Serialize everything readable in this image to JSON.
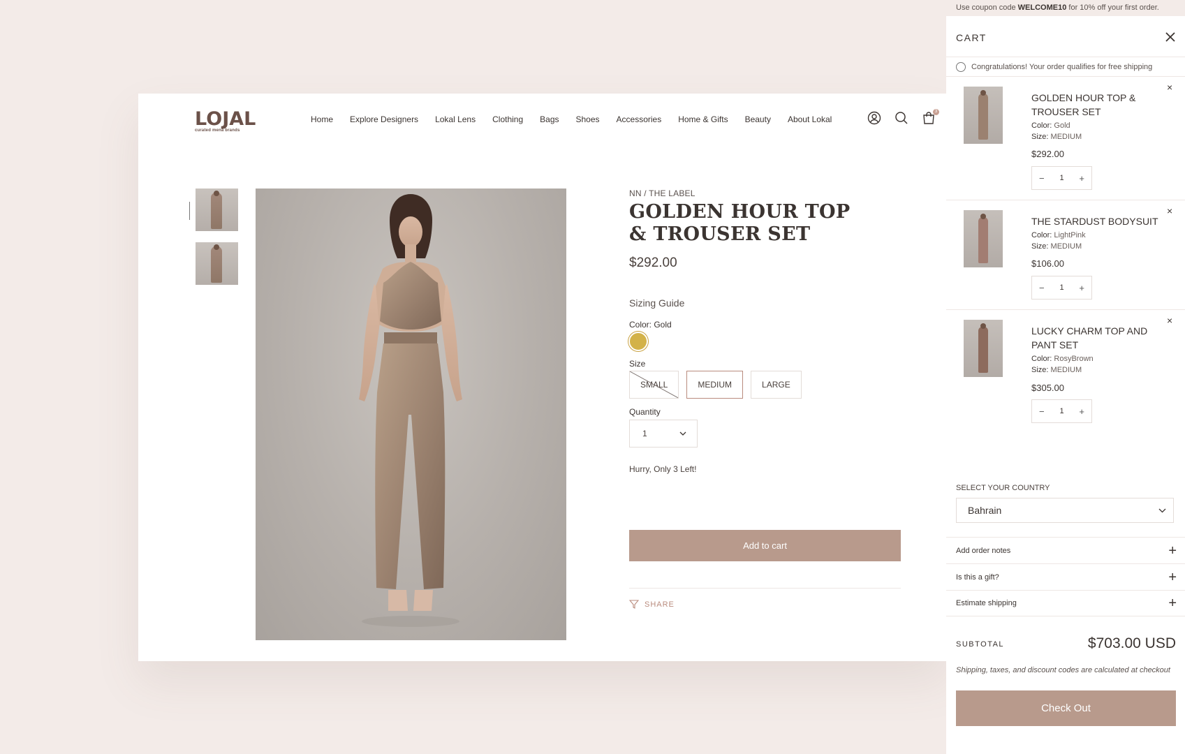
{
  "header": {
    "logo_text": "LOJAL",
    "logo_tagline": "curated mena brands",
    "nav": [
      "Home",
      "Explore Designers",
      "Lokal Lens",
      "Clothing",
      "Bags",
      "Shoes",
      "Accessories",
      "Home & Gifts",
      "Beauty",
      "About Lokal"
    ],
    "cart_count": "3"
  },
  "product": {
    "brand": "NN / THE LABEL",
    "title": "GOLDEN HOUR TOP & TROUSER SET",
    "price": "$292.00",
    "sizing_guide": "Sizing Guide",
    "color_label": "Color: Gold",
    "color_hex": "#d3b249",
    "size_label": "Size",
    "sizes": [
      "SMALL",
      "MEDIUM",
      "LARGE"
    ],
    "selected_size": "MEDIUM",
    "unavailable_size": "SMALL",
    "quantity_label": "Quantity",
    "quantity_value": "1",
    "stock_note": "Hurry, Only 3 Left!",
    "add_to_cart": "Add to cart",
    "share": "SHARE"
  },
  "cart": {
    "coupon_prefix": "Use coupon code ",
    "coupon_code": "WELCOME10",
    "coupon_suffix": " for 10% off your first order.",
    "title": "CART",
    "free_shipping": "Congratulations! Your order qualifies for free shipping",
    "items": [
      {
        "name": "GOLDEN HOUR TOP & TROUSER SET",
        "color_key": "Color:",
        "color": "Gold",
        "size_key": "Size:",
        "size": "MEDIUM",
        "price": "$292.00",
        "qty": "1",
        "swatch": "#9b8170"
      },
      {
        "name": "THE STARDUST BODYSUIT",
        "color_key": "Color:",
        "color": "LightPink",
        "size_key": "Size:",
        "size": "MEDIUM",
        "price": "$106.00",
        "qty": "1",
        "swatch": "#a27d72"
      },
      {
        "name": "LUCKY CHARM TOP AND PANT SET",
        "color_key": "Color:",
        "color": "RosyBrown",
        "size_key": "Size:",
        "size": "MEDIUM",
        "price": "$305.00",
        "qty": "1",
        "swatch": "#8d6b5d"
      }
    ],
    "country_label": "SELECT YOUR COUNTRY",
    "country_value": "Bahrain",
    "accordions": [
      "Add order notes",
      "Is this a gift?",
      "Estimate shipping"
    ],
    "subtotal_label": "SUBTOTAL",
    "subtotal_value": "$703.00 USD",
    "tax_note": "Shipping, taxes, and discount codes are calculated at checkout",
    "checkout": "Check Out"
  },
  "colors": {
    "accent": "#b89a8c",
    "background": "#f3ebe8"
  }
}
